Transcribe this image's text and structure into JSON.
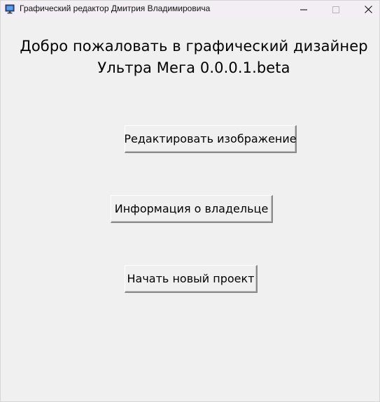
{
  "window": {
    "title": "Графический редактор Дмитрия Владимировича",
    "icons": {
      "app": "app-monitor-icon",
      "minimize": "minimize-icon",
      "maximize": "maximize-icon",
      "close": "close-icon"
    }
  },
  "main": {
    "heading_line1": "Добро пожаловать в графический дизайнер",
    "heading_line2": "Ультра Мега 0.0.0.1.beta",
    "buttons": {
      "edit_image": "Редактировать изображение",
      "owner_info": "Информация о владельце",
      "new_project": "Начать новый проект"
    }
  },
  "colors": {
    "background": "#f0f0f0",
    "titlebar": "#f3eef3"
  }
}
